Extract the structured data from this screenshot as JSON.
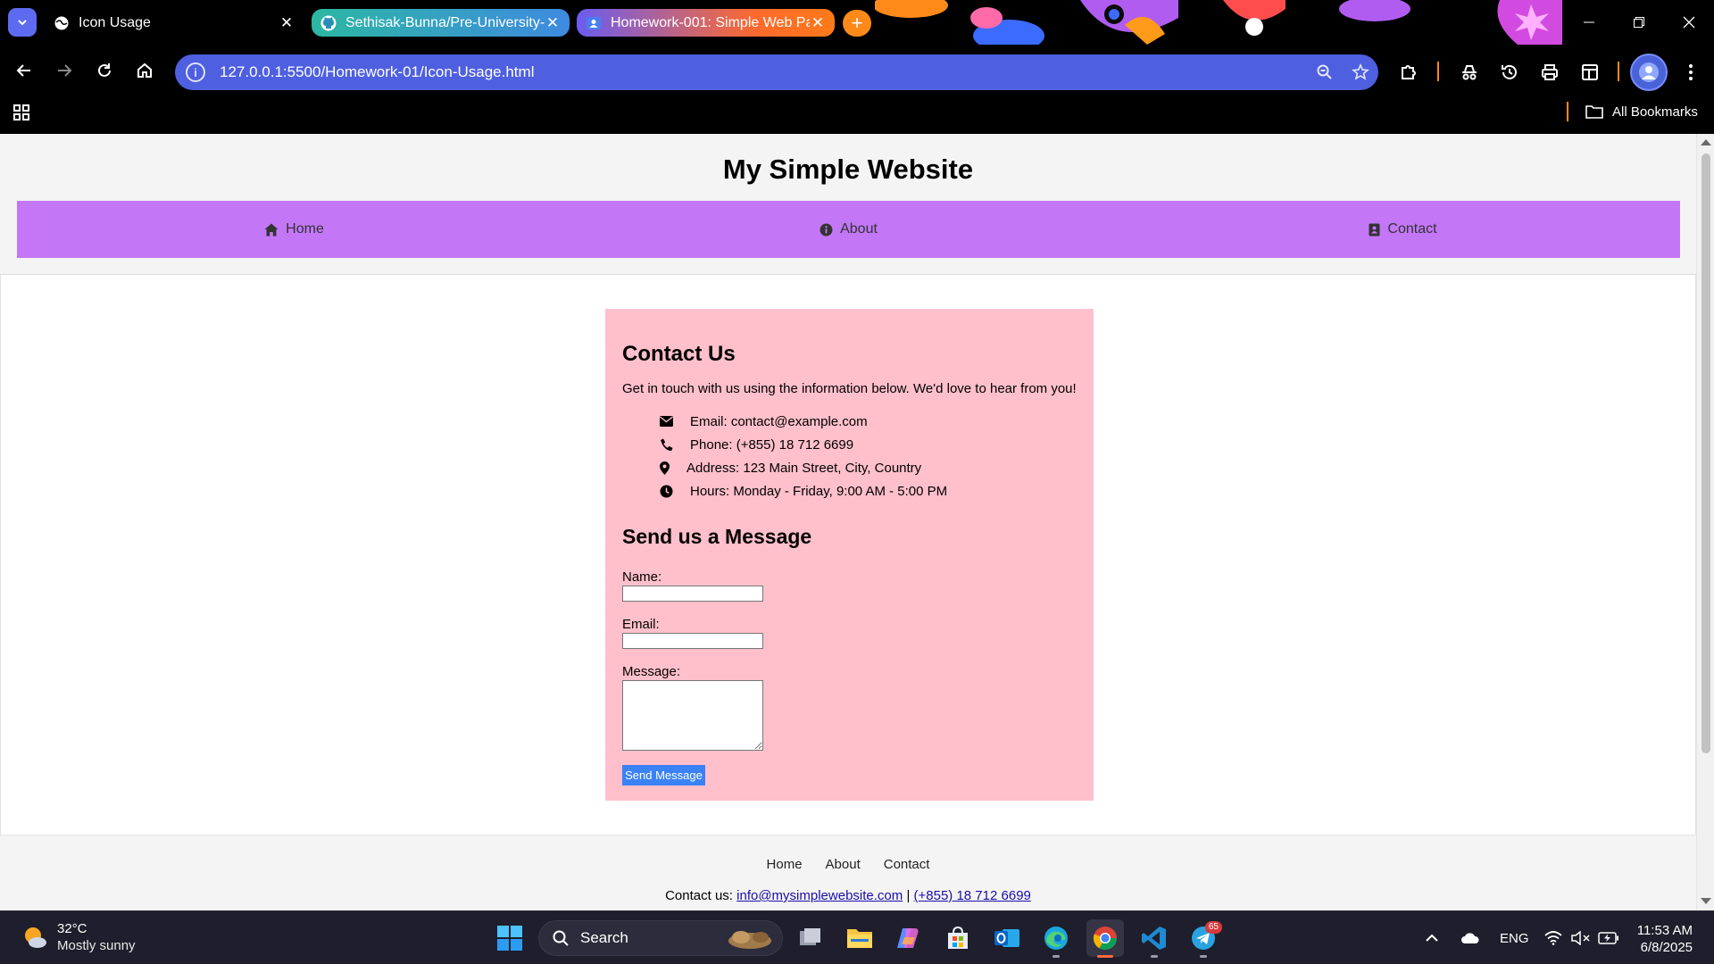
{
  "browser": {
    "tabs": [
      {
        "title": "Icon Usage",
        "active": true
      },
      {
        "title": "Sethisak-Bunna/Pre-University-",
        "active": false
      },
      {
        "title": "Homework-001: Simple Web Pa",
        "active": false
      }
    ],
    "new_tab_label": "+",
    "url": "127.0.0.1:5500/Homework-01/Icon-Usage.html",
    "bookmarks_label": "All Bookmarks",
    "accent_color": "#4e5fe0"
  },
  "site": {
    "title": "My Simple Website",
    "nav": [
      {
        "label": "Home",
        "icon": "home-icon"
      },
      {
        "label": "About",
        "icon": "info-circle-icon"
      },
      {
        "label": "Contact",
        "icon": "address-book-icon"
      }
    ],
    "nav_color": "#c377f7"
  },
  "contact": {
    "title": "Contact Us",
    "intro": "Get in touch with us using the information below. We'd love to hear from you!",
    "info": [
      {
        "icon": "envelope-icon",
        "text": "Email: contact@example.com"
      },
      {
        "icon": "phone-icon",
        "text": "Phone: (+855) 18 712 6699"
      },
      {
        "icon": "map-marker-icon",
        "text": "Address: 123 Main Street, City, Country"
      },
      {
        "icon": "clock-icon",
        "text": "Hours: Monday - Friday, 9:00 AM - 5:00 PM"
      }
    ],
    "card_color": "#ffc0cb"
  },
  "form": {
    "title": "Send us a Message",
    "name_label": "Name:",
    "name_value": "",
    "email_label": "Email:",
    "email_value": "",
    "message_label": "Message:",
    "message_value": "",
    "submit_label": "Send Message",
    "submit_color": "#3b82f6"
  },
  "footer": {
    "nav": [
      "Home",
      "About",
      "Contact"
    ],
    "contact_prefix": "Contact us:",
    "email": "info@mysimplewebsite.com",
    "separator": "|",
    "phone": "(+855) 18 712 6699"
  },
  "taskbar": {
    "weather_temp": "32°C",
    "weather_desc": "Mostly sunny",
    "search_label": "Search",
    "telegram_badge": "65",
    "language": "ENG",
    "time": "11:53 AM",
    "date": "6/8/2025"
  }
}
